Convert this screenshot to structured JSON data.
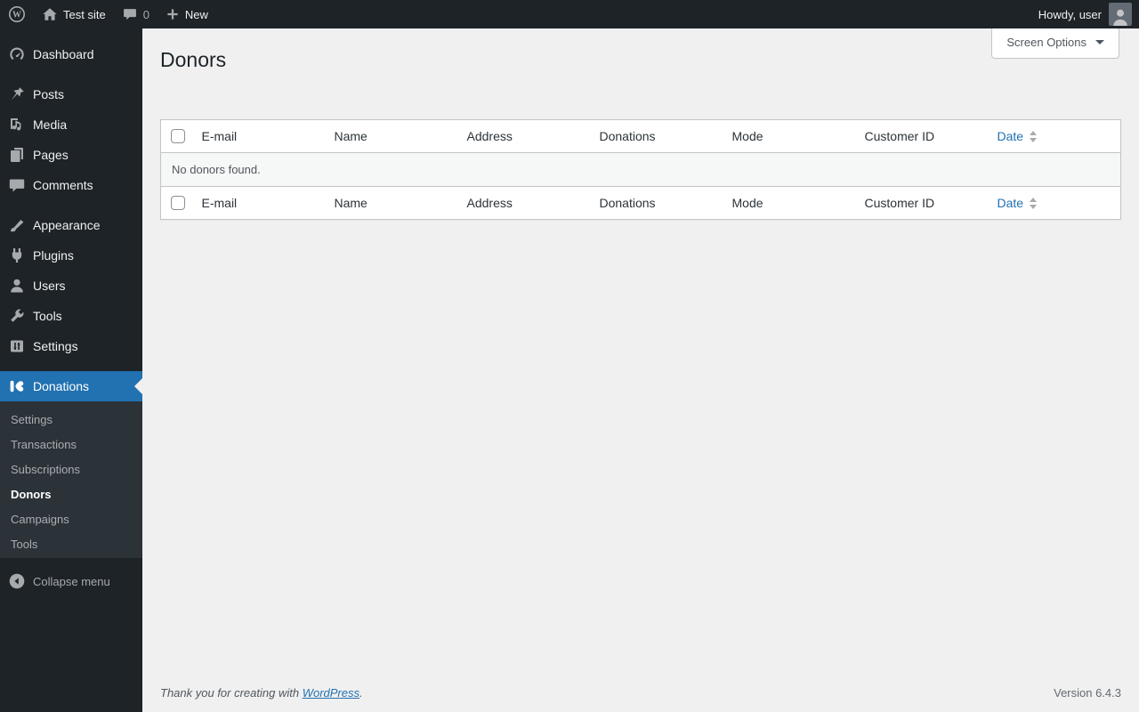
{
  "admin_bar": {
    "site_name": "Test site",
    "comment_count": "0",
    "new_label": "New",
    "howdy_text": "Howdy, user"
  },
  "sidebar": {
    "items": [
      {
        "label": "Dashboard",
        "icon": "dashboard-icon"
      },
      {
        "label": "Posts",
        "icon": "pushpin-icon"
      },
      {
        "label": "Media",
        "icon": "media-icon"
      },
      {
        "label": "Pages",
        "icon": "pages-icon"
      },
      {
        "label": "Comments",
        "icon": "comments-icon"
      },
      {
        "label": "Appearance",
        "icon": "appearance-brush-icon"
      },
      {
        "label": "Plugins",
        "icon": "plugin-icon"
      },
      {
        "label": "Users",
        "icon": "users-icon"
      },
      {
        "label": "Tools",
        "icon": "tools-wrench-icon"
      },
      {
        "label": "Settings",
        "icon": "settings-sliders-icon"
      }
    ],
    "donations_menu": {
      "label": "Donations",
      "icon": "kudos-donations-icon",
      "submenu": [
        {
          "label": "Settings"
        },
        {
          "label": "Transactions"
        },
        {
          "label": "Subscriptions"
        },
        {
          "label": "Donors",
          "current": true
        },
        {
          "label": "Campaigns"
        },
        {
          "label": "Tools"
        }
      ]
    },
    "collapse_label": "Collapse menu"
  },
  "main": {
    "page_title": "Donors",
    "screen_options_label": "Screen Options",
    "table": {
      "columns": [
        "E-mail",
        "Name",
        "Address",
        "Donations",
        "Mode",
        "Customer ID",
        "Date"
      ],
      "sortable_column": "Date",
      "empty_message": "No donors found."
    }
  },
  "footer": {
    "thanks_prefix": "Thank you for creating with ",
    "wordpress_link_label": "WordPress",
    "thanks_suffix": ".",
    "version": "Version 6.4.3"
  },
  "colors": {
    "accent_blue": "#2271b1",
    "sidebar_bg": "#1d2327",
    "submenu_bg": "#2c3338",
    "content_bg": "#f0f0f1",
    "table_border": "#c3c4c7",
    "striped_row": "#f6f7f7"
  }
}
